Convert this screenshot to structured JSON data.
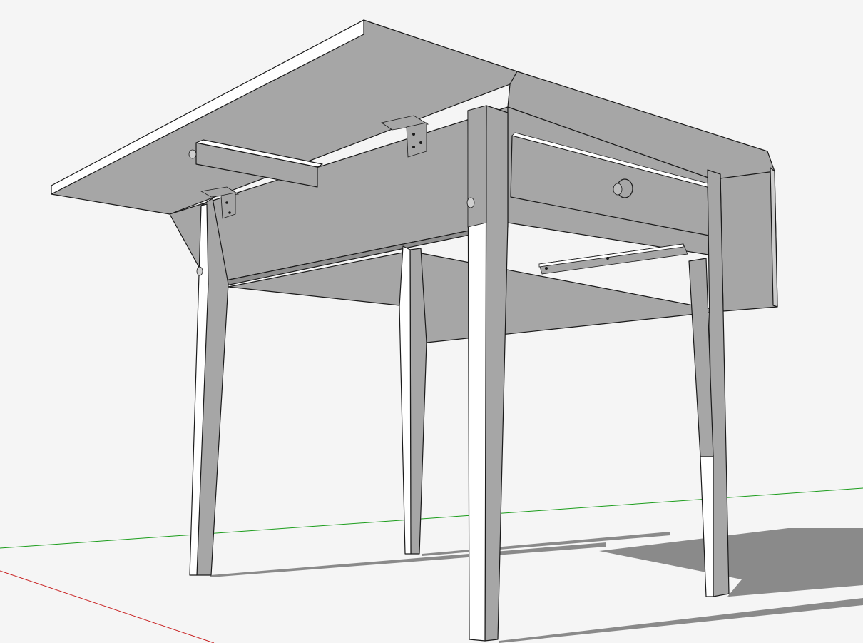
{
  "viewport": {
    "background": "#f5f5f5",
    "render_style": "hidden-line-shaded",
    "axes": {
      "red": "#c81e1e",
      "green": "#1a9c1a"
    },
    "colors": {
      "face_light": "#ffffff",
      "face_mid": "#a6a6a6",
      "face_dark": "#8e8e8e",
      "shadow": "#8a8a8a",
      "edge": "#1a1a1a"
    }
  },
  "model": {
    "type": "drop-leaf-table",
    "visible_parts": [
      "table-top",
      "drop-leaf",
      "apron",
      "drawer",
      "drawer-knob",
      "support-arm",
      "hinge",
      "leg",
      "drawer-runner"
    ]
  }
}
